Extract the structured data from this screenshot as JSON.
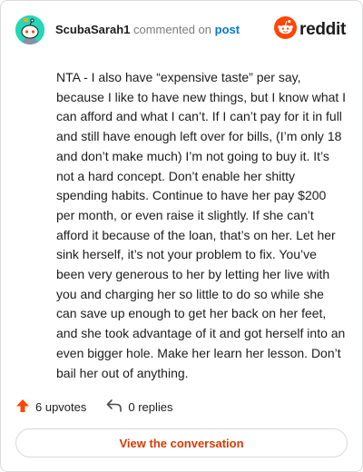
{
  "comment": {
    "username": "ScubaSarah1",
    "action_text": "commented on",
    "post_link": "post",
    "avatar_icon": "snoo-avatar-icon",
    "text": "NTA - I also have “expensive taste” per say, because I like to have new things, but I know what I can afford and what I can’t. If I can’t pay for it in full and still have enough left over for bills, (I’m only 18 and don’t make much) I’m not going to buy it. It’s not a hard concept. Don’t enable her shitty spending habits. Continue to have her pay $200 per month, or even raise it slightly. If she can’t afford it because of the loan, that’s on her. Let her sink herself, it’s not your problem to fix. You’ve been very generous to her by letting her live with you and charging her so little to do so while she can save up enough to get her back on her feet, and she took advantage of it and got herself into an even bigger hole. Make her learn her lesson. Don’t bail her out of anything."
  },
  "logo": {
    "text": "reddit",
    "icon": "reddit-logo-icon",
    "color": "#ff4500"
  },
  "actions": {
    "upvotes": "6 upvotes",
    "upvote_icon": "upvote-arrow-icon",
    "upvote_color": "#ff4500",
    "replies": "0 replies",
    "reply_icon": "reply-icon"
  },
  "cta": {
    "label": "View the conversation",
    "color": "#d93a00"
  }
}
